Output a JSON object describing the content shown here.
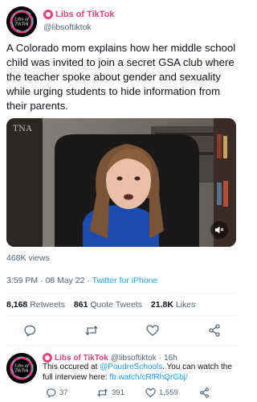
{
  "author": {
    "display_name": "Libs of TikTok",
    "handle": "@libsoftiktok",
    "avatar_text": "Libs of TikTok"
  },
  "tweet": {
    "text": "A Colorado mom explains how her middle school child was invited to join a secret GSA club where the teacher spoke about gender and sexuality while urging students to hide information from their parents.",
    "video_watermark": "TNA",
    "views": "468K views",
    "time": "3:59 PM",
    "date": "08 May 22",
    "separator": "·",
    "source": "Twitter for iPhone"
  },
  "stats": {
    "retweets_count": "8,168",
    "retweets_label": "Retweets",
    "quotes_count": "861",
    "quotes_label": "Quote Tweets",
    "likes_count": "21.8K",
    "likes_label": "Likes"
  },
  "actions": [
    "reply-icon",
    "retweet-icon",
    "like-icon",
    "share-icon"
  ],
  "reply": {
    "display_name": "Libs of TikTok",
    "handle": "@libsoftiktok",
    "dot": "·",
    "time_ago": "16h",
    "text_before": "This occured at ",
    "mention": "@PoudreSchools",
    "text_middle": ". You can watch the full interview here: ",
    "link": "fb.watch/cRfRhQrGbj/",
    "reply_count": "37",
    "retweet_count": "391",
    "like_count": "1,559"
  },
  "colors": {
    "brand": "#e3427d",
    "link": "#1d9bf0",
    "secondary_text": "#536471"
  }
}
